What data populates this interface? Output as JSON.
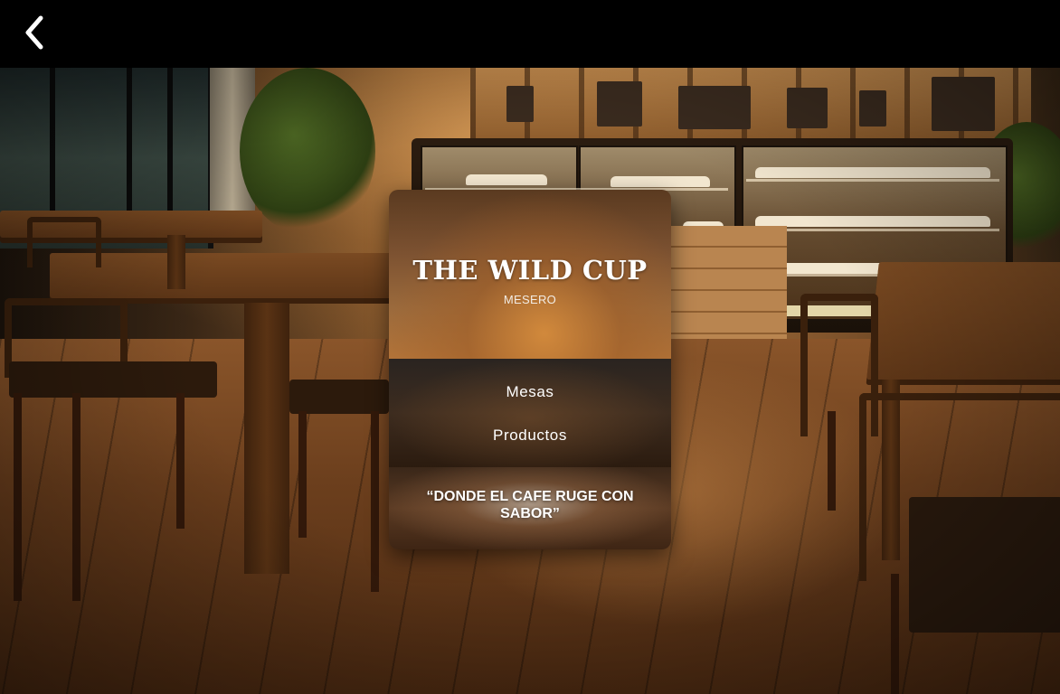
{
  "header": {
    "back_icon": "chevron-left-icon"
  },
  "card": {
    "title": "THE WILD CUP",
    "subtitle": "MESERO",
    "nav": [
      {
        "label": "Mesas"
      },
      {
        "label": "Productos"
      }
    ],
    "slogan": "“DONDE EL CAFE RUGE CON SABOR”"
  },
  "colors": {
    "topbar": "#000000",
    "text": "#ffffff",
    "wood": "#6c3f1d"
  }
}
